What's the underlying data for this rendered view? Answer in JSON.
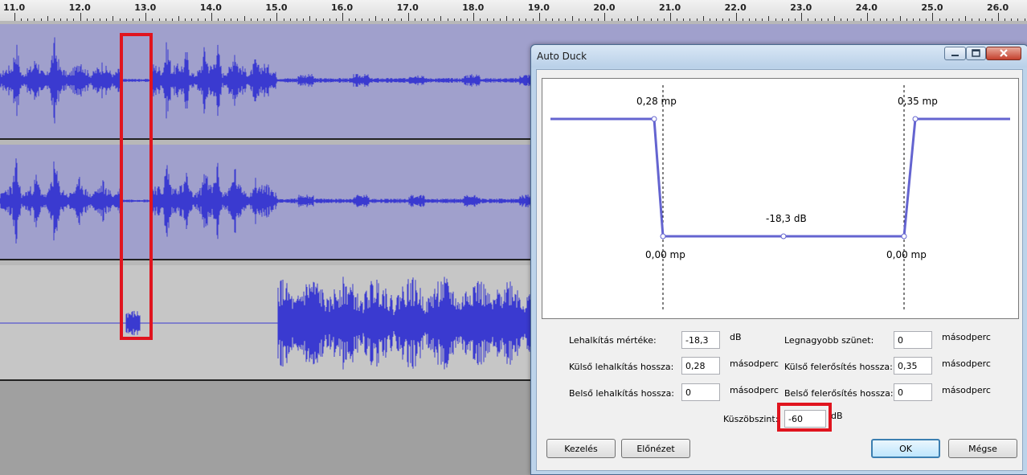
{
  "ruler": {
    "ticks": [
      "11.0",
      "12.0",
      "13.0",
      "14.0",
      "15.0",
      "16.0",
      "17.0",
      "18.0",
      "19.0",
      "20.0",
      "21.0",
      "22.0",
      "23.0",
      "24.0",
      "25.0",
      "26.0"
    ]
  },
  "colors": {
    "waveform": "#3a3ad0",
    "highlight": "#e0141e",
    "curve": "#6464d0"
  },
  "dialog": {
    "title": "Auto Duck",
    "graph": {
      "outer_fade_down": "0,28 mp",
      "outer_fade_up": "0,35 mp",
      "duck_amount": "-18,3 dB",
      "inner_fade_down": "0,00 mp",
      "inner_fade_up": "0,00 mp"
    },
    "fields": {
      "duck_amount_label": "Lehalkítás mértéke:",
      "duck_amount_value": "-18,3",
      "duck_amount_unit": "dB",
      "max_pause_label": "Legnagyobb szünet:",
      "max_pause_value": "0",
      "max_pause_unit": "másodperc",
      "outer_fade_down_label": "Külső lehalkítás hossza:",
      "outer_fade_down_value": "0,28",
      "outer_fade_down_unit": "másodperc",
      "outer_fade_up_label": "Külső felerősítés hossza:",
      "outer_fade_up_value": "0,35",
      "outer_fade_up_unit": "másodperc",
      "inner_fade_down_label": "Belső lehalkítás hossza:",
      "inner_fade_down_value": "0",
      "inner_fade_down_unit": "másodperc",
      "inner_fade_up_label": "Belső felerősítés hossza:",
      "inner_fade_up_value": "0",
      "inner_fade_up_unit": "másodperc",
      "threshold_label": "Küszöbszint:",
      "threshold_value": "-60",
      "threshold_unit": "dB"
    },
    "buttons": {
      "manage": "Kezelés",
      "preview": "Előnézet",
      "ok": "OK",
      "cancel": "Mégse"
    },
    "window_buttons": {
      "minimize": "minimize-icon",
      "maximize": "maximize-icon",
      "close": "close-icon"
    }
  }
}
